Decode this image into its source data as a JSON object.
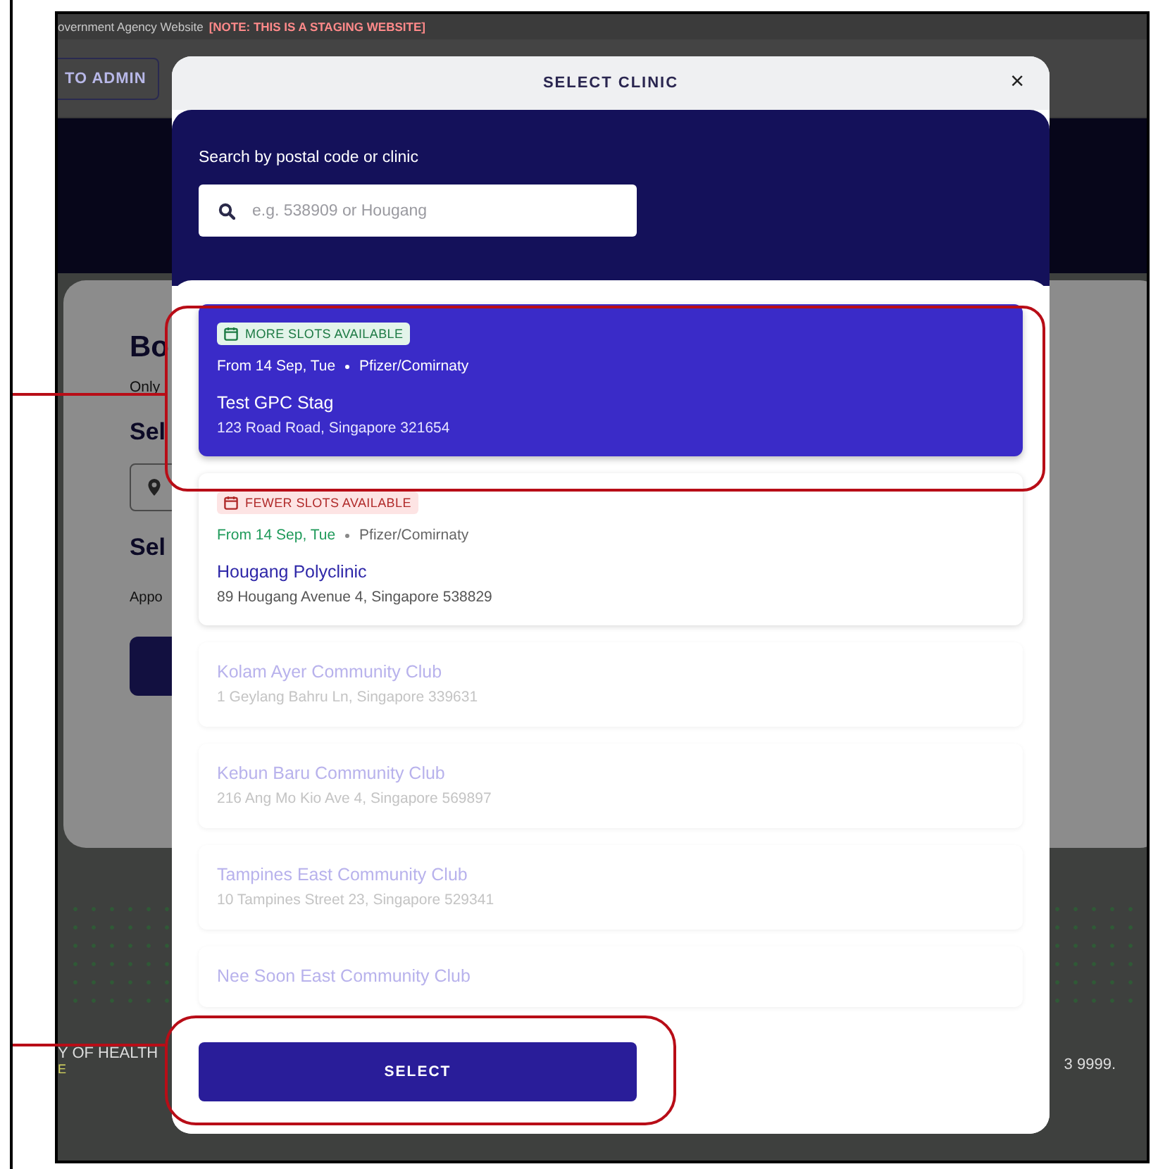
{
  "background_page": {
    "banner": "overnment Agency Website",
    "banner_note": "[NOTE: THIS IS A STAGING WEBSITE]",
    "admin_button": "TO ADMIN",
    "card_title": "Bo",
    "card_subtitle": "Only",
    "section_1": "Sel",
    "section_2": "Sel",
    "appointment_label": "Appo",
    "footer_left": "Y OF HEALTH",
    "footer_left_2": "E",
    "footer_right": "3 9999."
  },
  "modal": {
    "title": "SELECT CLINIC",
    "close": "×",
    "search_label": "Search by postal code or clinic",
    "search": {
      "placeholder": "e.g. 538909 or Hougang"
    },
    "clinics": [
      {
        "name": "Test GPC Stag",
        "address": "123 Road Road, Singapore 321654",
        "selected": true,
        "disabled": false,
        "availability": {
          "kind": "more",
          "label": "MORE SLOTS AVAILABLE"
        },
        "date": "From 14 Sep, Tue",
        "vaccine": "Pfizer/Comirnaty"
      },
      {
        "name": "Hougang Polyclinic",
        "address": "89 Hougang Avenue 4, Singapore 538829",
        "selected": false,
        "disabled": false,
        "availability": {
          "kind": "fewer",
          "label": "FEWER SLOTS AVAILABLE"
        },
        "date": "From 14 Sep, Tue",
        "vaccine": "Pfizer/Comirnaty"
      },
      {
        "name": "Kolam Ayer Community Club",
        "address": "1 Geylang Bahru Ln, Singapore 339631",
        "selected": false,
        "disabled": true
      },
      {
        "name": "Kebun Baru Community Club",
        "address": "216 Ang Mo Kio Ave 4, Singapore 569897",
        "selected": false,
        "disabled": true
      },
      {
        "name": "Tampines East Community Club",
        "address": "10 Tampines Street 23, Singapore 529341",
        "selected": false,
        "disabled": true
      },
      {
        "name": "Nee Soon East Community Club",
        "selected": false,
        "disabled": true
      }
    ],
    "select_button": "SELECT"
  }
}
